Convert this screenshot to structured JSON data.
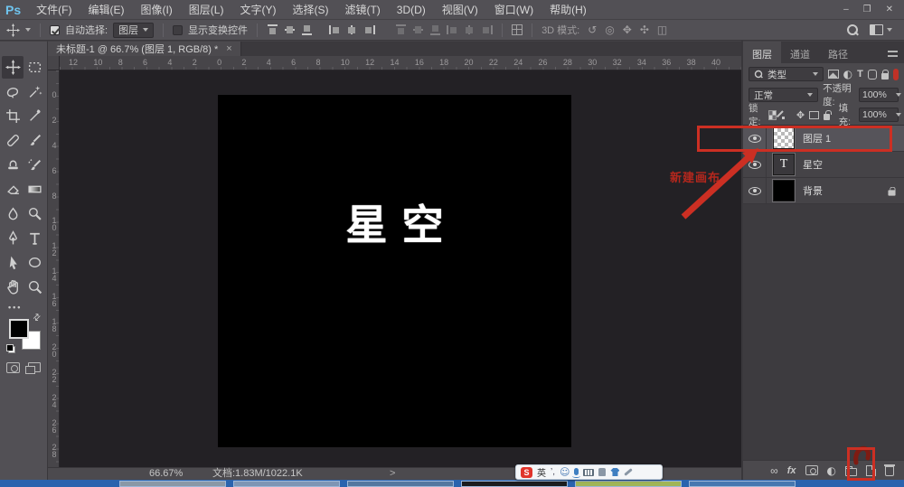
{
  "window": {
    "minimize": "–",
    "restore": "❐",
    "close": "✕"
  },
  "menu": {
    "logo": "Ps",
    "items": [
      "文件(F)",
      "编辑(E)",
      "图像(I)",
      "图层(L)",
      "文字(Y)",
      "选择(S)",
      "滤镜(T)",
      "3D(D)",
      "视图(V)",
      "窗口(W)",
      "帮助(H)"
    ]
  },
  "options": {
    "auto_select_label": "自动选择:",
    "auto_select_value": "图层",
    "show_transform_label": "显示变换控件",
    "mode_label": "3D 模式:",
    "mode_icons": [
      "↺",
      "◎",
      "✥",
      "✣",
      "◫"
    ]
  },
  "doc_tab": {
    "title": "未标题-1 @ 66.7% (图层 1, RGB/8) *",
    "close": "×"
  },
  "rulers": {
    "top": [
      "12",
      "10",
      "8",
      "6",
      "4",
      "2",
      "0",
      "2",
      "4",
      "6",
      "8",
      "10",
      "12",
      "14",
      "16",
      "18",
      "20",
      "22",
      "24",
      "26",
      "28",
      "30",
      "32",
      "34",
      "36",
      "38",
      "40"
    ],
    "left": [
      "0",
      "2",
      "4",
      "6",
      "8",
      "10",
      "12",
      "14",
      "16",
      "18",
      "20",
      "22",
      "24",
      "26",
      "28"
    ]
  },
  "canvas": {
    "text": "星空"
  },
  "status": {
    "zoom": "66.67%",
    "doc": "文档:1.83M/1022.1K",
    "chevron": ">"
  },
  "panel": {
    "tabs": [
      "图层",
      "通道",
      "路径"
    ],
    "filter": {
      "label": "类型",
      "adjust_glyph": "◐",
      "type_glyph": "T"
    },
    "blend_mode": "正常",
    "opacity_label": "不透明度:",
    "opacity_value": "100%",
    "lock_label": "锁定:",
    "move_glyph": "✥",
    "fill_label": "填充:",
    "fill_value": "100%",
    "layers": [
      {
        "name": "图层 1",
        "thumb": "checker",
        "selected": true
      },
      {
        "name": "星空",
        "thumb": "text",
        "thumb_glyph": "T"
      },
      {
        "name": "背景",
        "thumb": "black",
        "locked": true
      }
    ],
    "bottom": {
      "link": "∞",
      "fx": "fx",
      "adjust": "◐"
    }
  },
  "annotations": {
    "label": "新建画布"
  },
  "ime": {
    "logo": "S",
    "lang": "英",
    "punct": "’,",
    "smiley": "☺"
  },
  "taskbar": {
    "thumbs": [
      "background:#8a98a6",
      "background:#7e95b4",
      "background:#53779f",
      "background:#1c1c1e",
      "background:#a0b557",
      "background:#4677b0"
    ]
  },
  "colors": {
    "accent_red": "#cc2f23",
    "dark_red": "#7e1b12",
    "ps_blue": "#6fc4ee",
    "taskbar_blue": "#2a63ae"
  }
}
